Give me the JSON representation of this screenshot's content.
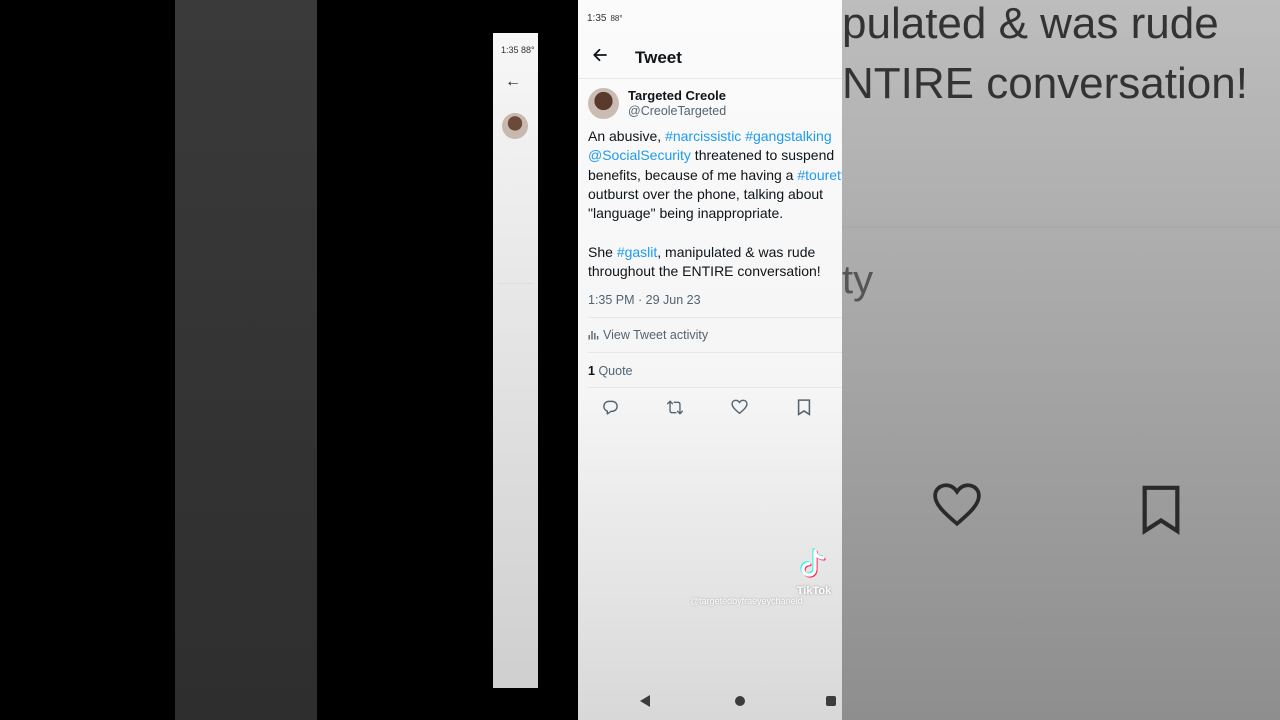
{
  "status_bar": {
    "time": "1:35",
    "temperature": "88°"
  },
  "header": {
    "back_icon": "arrow-left-icon",
    "title": "Tweet"
  },
  "tweet": {
    "author_name": "Targeted Creole",
    "author_handle": "@CreoleTargeted",
    "lines": [
      [
        {
          "text": "An abusive, ",
          "tag": false
        },
        {
          "text": "#narcissistic",
          "tag": true
        },
        {
          "text": " ",
          "tag": false
        },
        {
          "text": "#gangstalking",
          "tag": true
        }
      ],
      [
        {
          "text": "@SocialSecurity",
          "tag": true
        },
        {
          "text": " threatened to suspend",
          "tag": false
        }
      ],
      [
        {
          "text": "benefits, because of me having a ",
          "tag": false
        },
        {
          "text": "#tourettes",
          "tag": true
        }
      ],
      [
        {
          "text": "outburst over the phone, talking about",
          "tag": false
        }
      ],
      [
        {
          "text": "\"language\" being inappropriate.",
          "tag": false
        }
      ],
      [
        {
          "text": "",
          "tag": false
        }
      ],
      [
        {
          "text": "She ",
          "tag": false
        },
        {
          "text": "#gaslit",
          "tag": true
        },
        {
          "text": ", manipulated & was rude",
          "tag": false
        }
      ],
      [
        {
          "text": "throughout the ENTIRE conversation!",
          "tag": false
        }
      ]
    ],
    "timestamp": "1:35 PM · 29 Jun 23",
    "activity_label": "View Tweet activity",
    "quote_count": "1",
    "quote_label": "Quote"
  },
  "actions": [
    "reply-icon",
    "retweet-icon",
    "like-icon",
    "bookmark-icon"
  ],
  "overlay": {
    "tiktok_label": "TikTok",
    "watermark": "@targetedbyfraeyeychaneld"
  },
  "background_zoom": {
    "line1": "pulated & was rude",
    "line2": "NTIRE conversation!",
    "line3": "ty"
  },
  "mini_status": "1:35  88°",
  "colors": {
    "link": "#1d9bf0",
    "text": "#0f1419",
    "muted": "#536471"
  }
}
